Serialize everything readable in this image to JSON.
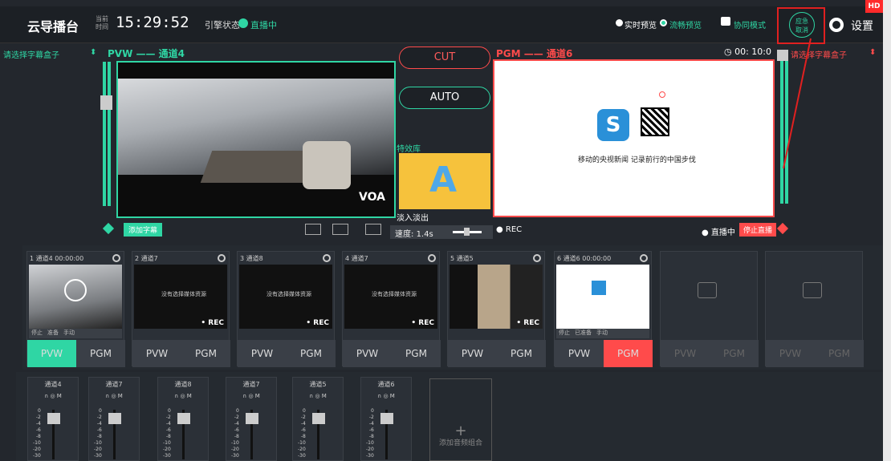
{
  "header": {
    "app_title": "云导播台",
    "time_label_1": "当前",
    "time_label_2": "时间",
    "time": "15:29:52",
    "engine_label": "引擎状态",
    "engine_status": "直播中",
    "realtime_preview": "实时预览",
    "smooth_preview": "流畅预览",
    "collab_mode": "协同模式",
    "emergency_1": "应急",
    "emergency_2": "取消",
    "settings": "设置",
    "hd": "HD"
  },
  "pvw": {
    "subtitle_select": "请选择字幕盒子",
    "title": "PVW —— 通道4",
    "add_subtitle": "添加字幕"
  },
  "center": {
    "cut": "CUT",
    "auto": "AUTO",
    "effects_lib": "特效库",
    "fade": "淡入淡出",
    "speed_label": "速度:",
    "speed": "1.4s"
  },
  "pgm": {
    "title": "PGM —— 通道6",
    "timer": "00: 10:0",
    "subtitle_select": "请选择字幕盒子",
    "caption": "移动的央视新闻 记录前行的中国步伐",
    "rec": "REC",
    "live": "直播中",
    "stop": "停止直播"
  },
  "channels": [
    {
      "label": "1 通道4",
      "time": "00:00:00",
      "status": [
        "停止",
        "准备",
        "手动"
      ],
      "rec": "",
      "pvw": "PVW",
      "pgm": "PGM",
      "active": "pvw"
    },
    {
      "label": "2 通道7",
      "time": "",
      "status": [],
      "rec": "• REC",
      "nores": "没有选择媒体资源",
      "pvw": "PVW",
      "pgm": "PGM"
    },
    {
      "label": "3 通道8",
      "time": "",
      "status": [],
      "rec": "• REC",
      "nores": "没有选择媒体资源",
      "pvw": "PVW",
      "pgm": "PGM"
    },
    {
      "label": "4 通道7",
      "time": "",
      "status": [],
      "rec": "• REC",
      "nores": "没有选择媒体资源",
      "pvw": "PVW",
      "pgm": "PGM"
    },
    {
      "label": "5 通道5",
      "time": "",
      "status": [],
      "rec": "• REC",
      "pvw": "PVW",
      "pgm": "PGM"
    },
    {
      "label": "6 通道6",
      "time": "00:00:00",
      "status": [
        "停止",
        "已准备",
        "手动"
      ],
      "rec": "",
      "pvw": "PVW",
      "pgm": "PGM",
      "active": "pgm"
    },
    {
      "label": "",
      "pvw": "PVW",
      "pgm": "PGM"
    },
    {
      "label": "",
      "pvw": "PVW",
      "pgm": "PGM"
    }
  ],
  "mixer": {
    "channels": [
      "通道4",
      "通道7",
      "通道8",
      "通道7",
      "通道5",
      "通道6"
    ],
    "add_label": "添加音频组合",
    "scale": [
      "0",
      "-2",
      "-4",
      "-6",
      "-8",
      "-10",
      "-20",
      "-30"
    ]
  },
  "colors": {
    "green": "#2fd6a4",
    "red": "#ff4b4b"
  }
}
